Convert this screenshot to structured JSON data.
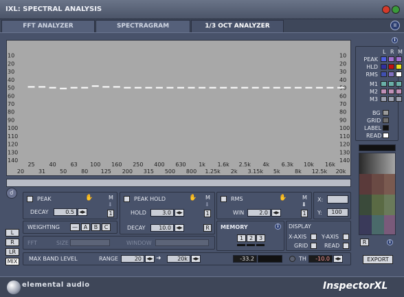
{
  "window": {
    "title": "IXL: SPECTRAL ANALYSIS"
  },
  "tabs": [
    {
      "label": "FFT ANALYZER"
    },
    {
      "label": "SPECTRAGRAM"
    },
    {
      "label": "1/3 OCT ANALYZER"
    }
  ],
  "chart_data": {
    "type": "line",
    "title": "",
    "xlabel": "",
    "ylabel": "",
    "y_ticks": [
      "10",
      "20",
      "30",
      "40",
      "50",
      "60",
      "70",
      "80",
      "90",
      "100",
      "110",
      "120",
      "130",
      "140"
    ],
    "y_ticks_right": [
      "10",
      "20",
      "30",
      "40",
      "50",
      "60",
      "70",
      "80",
      "90",
      "100",
      "110",
      "120",
      "130",
      "140"
    ],
    "x_ticks_upper": [
      "25",
      "40",
      "63",
      "100",
      "160",
      "250",
      "400",
      "630",
      "1k",
      "1.6k",
      "2.5k",
      "4k",
      "6.3k",
      "10k",
      "16k"
    ],
    "x_ticks_lower": [
      "20",
      "31",
      "50",
      "80",
      "125",
      "200",
      "315",
      "500",
      "800",
      "1.25k",
      "2k",
      "3.15k",
      "5k",
      "8k",
      "12.5k",
      "20k"
    ],
    "bands": [
      "20",
      "25",
      "31",
      "40",
      "50",
      "63",
      "80",
      "100",
      "125",
      "160",
      "200",
      "250",
      "315",
      "400",
      "500",
      "630",
      "800",
      "1k",
      "1.25k",
      "1.6k",
      "2k",
      "2.5k",
      "3.15k",
      "4k",
      "5k",
      "6.3k",
      "8k",
      "10k",
      "12.5k",
      "16k",
      "20k"
    ],
    "series": [
      {
        "values": [
          51,
          49,
          49,
          50,
          51,
          50,
          50,
          48,
          49,
          49,
          50,
          50,
          50,
          50,
          50,
          50,
          50,
          50,
          50,
          50,
          50,
          50,
          50,
          50,
          50,
          50,
          50,
          50,
          50,
          50,
          50
        ]
      }
    ],
    "ylim": [
      140,
      0
    ],
    "grid": false
  },
  "legend": {
    "headers": [
      "L",
      "R",
      "M"
    ],
    "rows": [
      {
        "label": "PEAK",
        "colors": [
          "#5060e0",
          "#a070d0",
          "#a070d0"
        ]
      },
      {
        "label": "HLD",
        "colors": [
          "#3030a0",
          "#c01010",
          "#e8e020"
        ]
      },
      {
        "label": "RMS",
        "colors": [
          "#4050b0",
          "#8070c0",
          "#ffffff"
        ]
      },
      {
        "label": "M1",
        "colors": [
          "#6ab0a8",
          "#6ab0a8",
          "#6ab0a8"
        ]
      },
      {
        "label": "M2",
        "colors": [
          "#c090b8",
          "#c090b8",
          "#c090b8"
        ]
      },
      {
        "label": "M3",
        "colors": [
          "#9ca0b0",
          "#9ca0b0",
          "#9ca0b0"
        ]
      }
    ],
    "bg_label": "BG",
    "bg_color": "#9a9a9a",
    "grid_label": "GRID",
    "grid_color": "#6e6e6e",
    "label_label": "LABEL",
    "label_color": "#111111",
    "read_label": "READ",
    "read_color": "#ffffff"
  },
  "peak": {
    "label": "PEAK",
    "decay_label": "DECAY",
    "decay_value": "0.5",
    "m": "M",
    "num": "1"
  },
  "peakhold": {
    "label": "PEAK HOLD",
    "hold_label": "HOLD",
    "hold_value": "3.0",
    "decay_label": "DECAY",
    "decay_value": "10.0",
    "m": "M",
    "num": "1",
    "r": "R"
  },
  "rms": {
    "label": "RMS",
    "win_label": "WIN",
    "win_value": "2.0",
    "m": "M",
    "num": "1"
  },
  "xy": {
    "x_label": "X:",
    "x_value": "",
    "y_label": "Y:",
    "y_value": "100"
  },
  "weighting": {
    "label": "WEIGHTING",
    "options": [
      "—",
      "A",
      "B",
      "C"
    ]
  },
  "fft": {
    "label": "FFT",
    "size_label": "SIZE",
    "window_label": "WINDOW"
  },
  "memory": {
    "label": "MEMORY",
    "buttons": [
      "1",
      "2",
      "3"
    ]
  },
  "display": {
    "label": "DISPLAY",
    "xaxis": "X-AXIS",
    "yaxis": "Y-AXIS",
    "grid": "GRID",
    "read": "READ"
  },
  "channels": [
    "L",
    "R",
    "LR",
    "MIX"
  ],
  "band": {
    "label": "MAX BAND LEVEL",
    "range_label": "RANGE",
    "from": "20",
    "to": "20k",
    "level": "-33.2",
    "th_label": "TH",
    "th_value": "-10.0"
  },
  "export_label": "EXPORT",
  "palette_r": "R",
  "brand": {
    "logo": "elemental audio",
    "product": "InspectorXL"
  }
}
